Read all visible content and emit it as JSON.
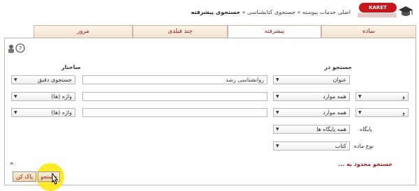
{
  "header": {
    "logo_text": "KARET",
    "breadcrumb": "اصلی خدمات پیوسته » جستجوی کتابشناسی »",
    "breadcrumb_current": "جستجوی پیشرفته"
  },
  "tabs": [
    {
      "label": "ساده"
    },
    {
      "label": "پیشرفته"
    },
    {
      "label": "چند فیلدی"
    },
    {
      "label": "مرور"
    }
  ],
  "labels": {
    "search_in": "جستجو در",
    "structure": "ساختار",
    "database": "پایگاه",
    "material_type": "نوع ماده",
    "limit": "جستجو محدود به ..."
  },
  "rows": [
    {
      "op": "",
      "field": "عنوان",
      "query": "روانشناسی رشد",
      "structure": "جستجوی دقیق"
    },
    {
      "op": "و",
      "field": "همه موارد",
      "query": "",
      "structure": "واژه (ها)"
    },
    {
      "op": "و",
      "field": "همه موارد",
      "query": "",
      "structure": "واژه (ها)"
    }
  ],
  "database_value": "همه پایگاه ها",
  "material_value": "کتاب",
  "buttons": {
    "search": "جستجو",
    "clear": "پاک کن"
  },
  "icons": {
    "help": "help-icon",
    "user": "user-question-icon",
    "cap": "graduation-cap-icon",
    "chevron": "double-chevron-down-icon"
  },
  "colors": {
    "accent": "#a31515",
    "highlight": "#ffe600",
    "logo": "#c8161d"
  }
}
